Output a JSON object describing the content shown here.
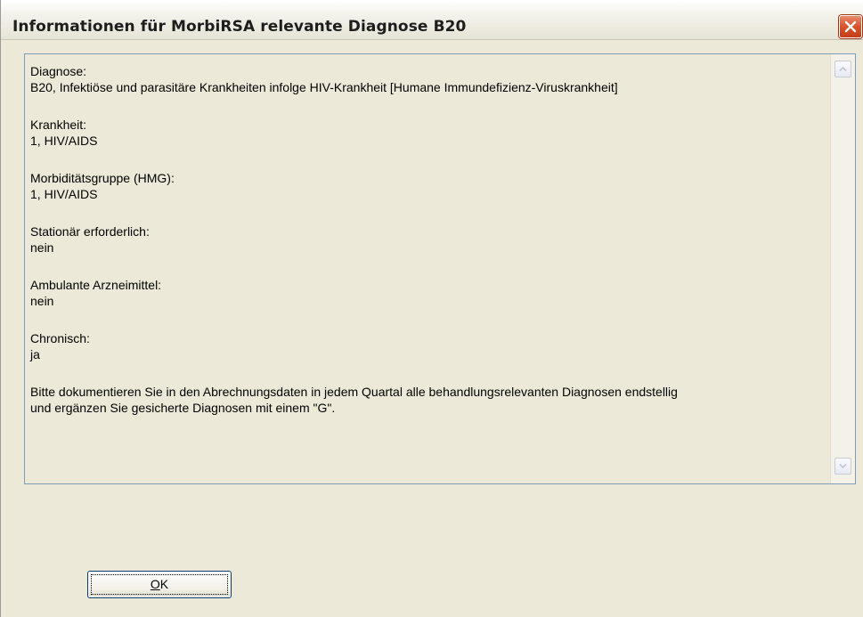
{
  "window": {
    "title": "Informationen für MorbiRSA relevante Diagnose B20"
  },
  "info": {
    "diagnose_label": "Diagnose:",
    "diagnose_value": "B20,  Infektiöse und parasitäre Krankheiten infolge HIV-Krankheit [Humane Immundefizienz-Viruskrankheit]",
    "krankheit_label": "Krankheit:",
    "krankheit_value": "1,  HIV/AIDS",
    "hmg_label": "Morbiditätsgruppe (HMG):",
    "hmg_value": "1,  HIV/AIDS",
    "stationaer_label": "Stationär erforderlich:",
    "stationaer_value": "nein",
    "arzneimittel_label": "Ambulante Arzneimittel:",
    "arzneimittel_value": "nein",
    "chronisch_label": "Chronisch:",
    "chronisch_value": "ja",
    "hinweis_line1": "Bitte dokumentieren Sie in den Abrechnungsdaten in jedem Quartal alle behandlungsrelevanten Diagnosen endstellig",
    "hinweis_line2": "und ergänzen Sie gesicherte Diagnosen mit einem \"G\"."
  },
  "buttons": {
    "ok_mnemonic": "O",
    "ok_rest": "K"
  },
  "icons": {
    "close": "close-icon",
    "scroll_up": "scroll-up-arrow-icon",
    "scroll_down": "scroll-down-arrow-icon"
  }
}
